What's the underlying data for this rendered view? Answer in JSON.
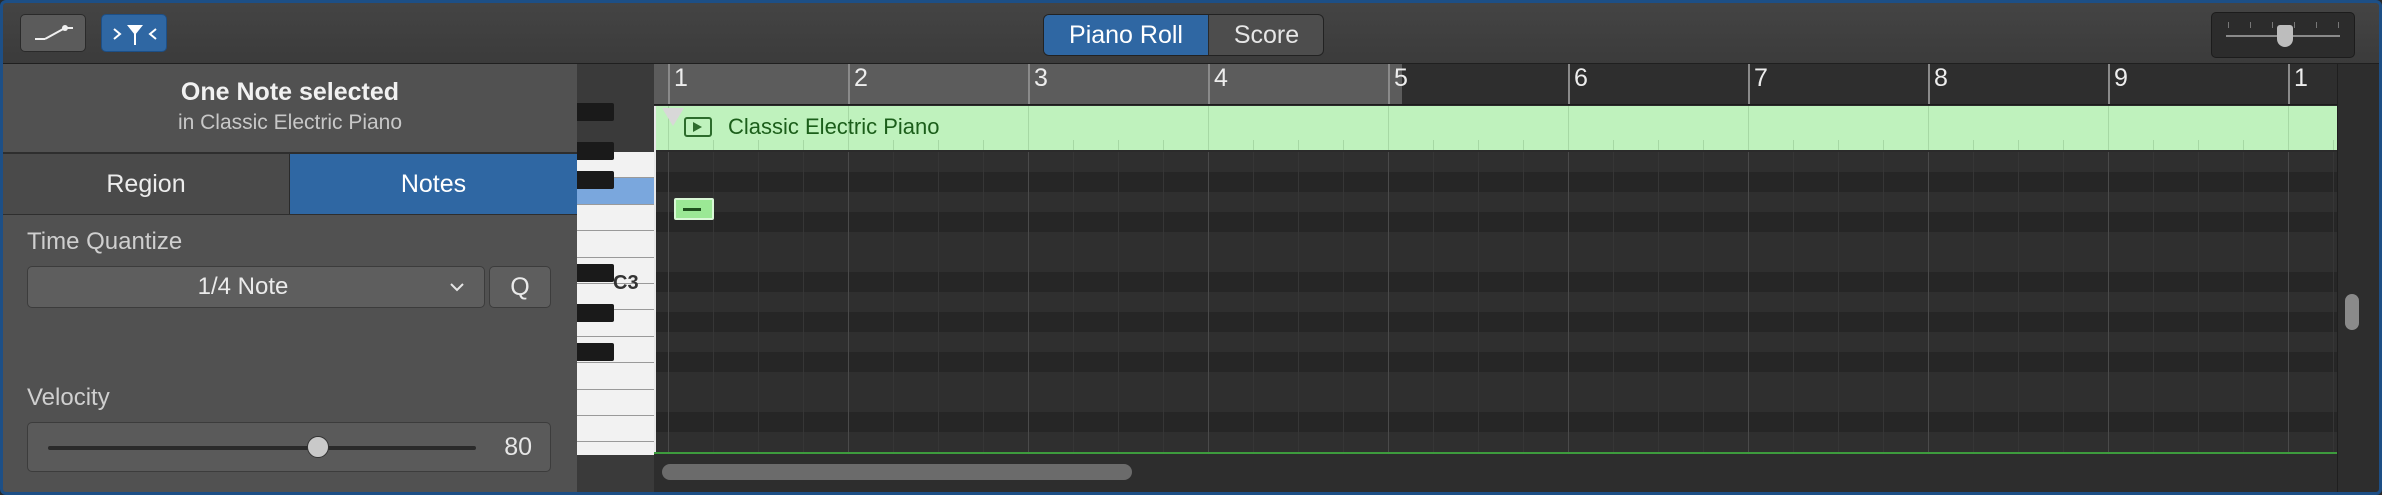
{
  "toolbar": {
    "automation_icon": "automation-curve-icon",
    "catch_icon": "catch-playhead-icon",
    "view_tabs": [
      {
        "label": "Piano Roll",
        "active": true
      },
      {
        "label": "Score",
        "active": false
      }
    ],
    "zoom_slider_value": 0.52
  },
  "inspector": {
    "selection_title": "One Note selected",
    "selection_subtitle": "in Classic Electric Piano",
    "tabs": [
      {
        "label": "Region",
        "active": false
      },
      {
        "label": "Notes",
        "active": true
      }
    ],
    "time_quantize": {
      "label": "Time Quantize",
      "value": "1/4 Note",
      "q_label": "Q"
    },
    "velocity": {
      "label": "Velocity",
      "value": "80",
      "fraction": 0.63
    }
  },
  "keyboard": {
    "c3_label": "C3"
  },
  "editor": {
    "bars": [
      "1",
      "2",
      "3",
      "4",
      "5",
      "6",
      "7",
      "8",
      "9",
      "1"
    ],
    "region_name": "Classic Electric Piano",
    "accent_color": "#2f67a3",
    "region_color": "#bff2bd",
    "note_color": "#9be895"
  }
}
